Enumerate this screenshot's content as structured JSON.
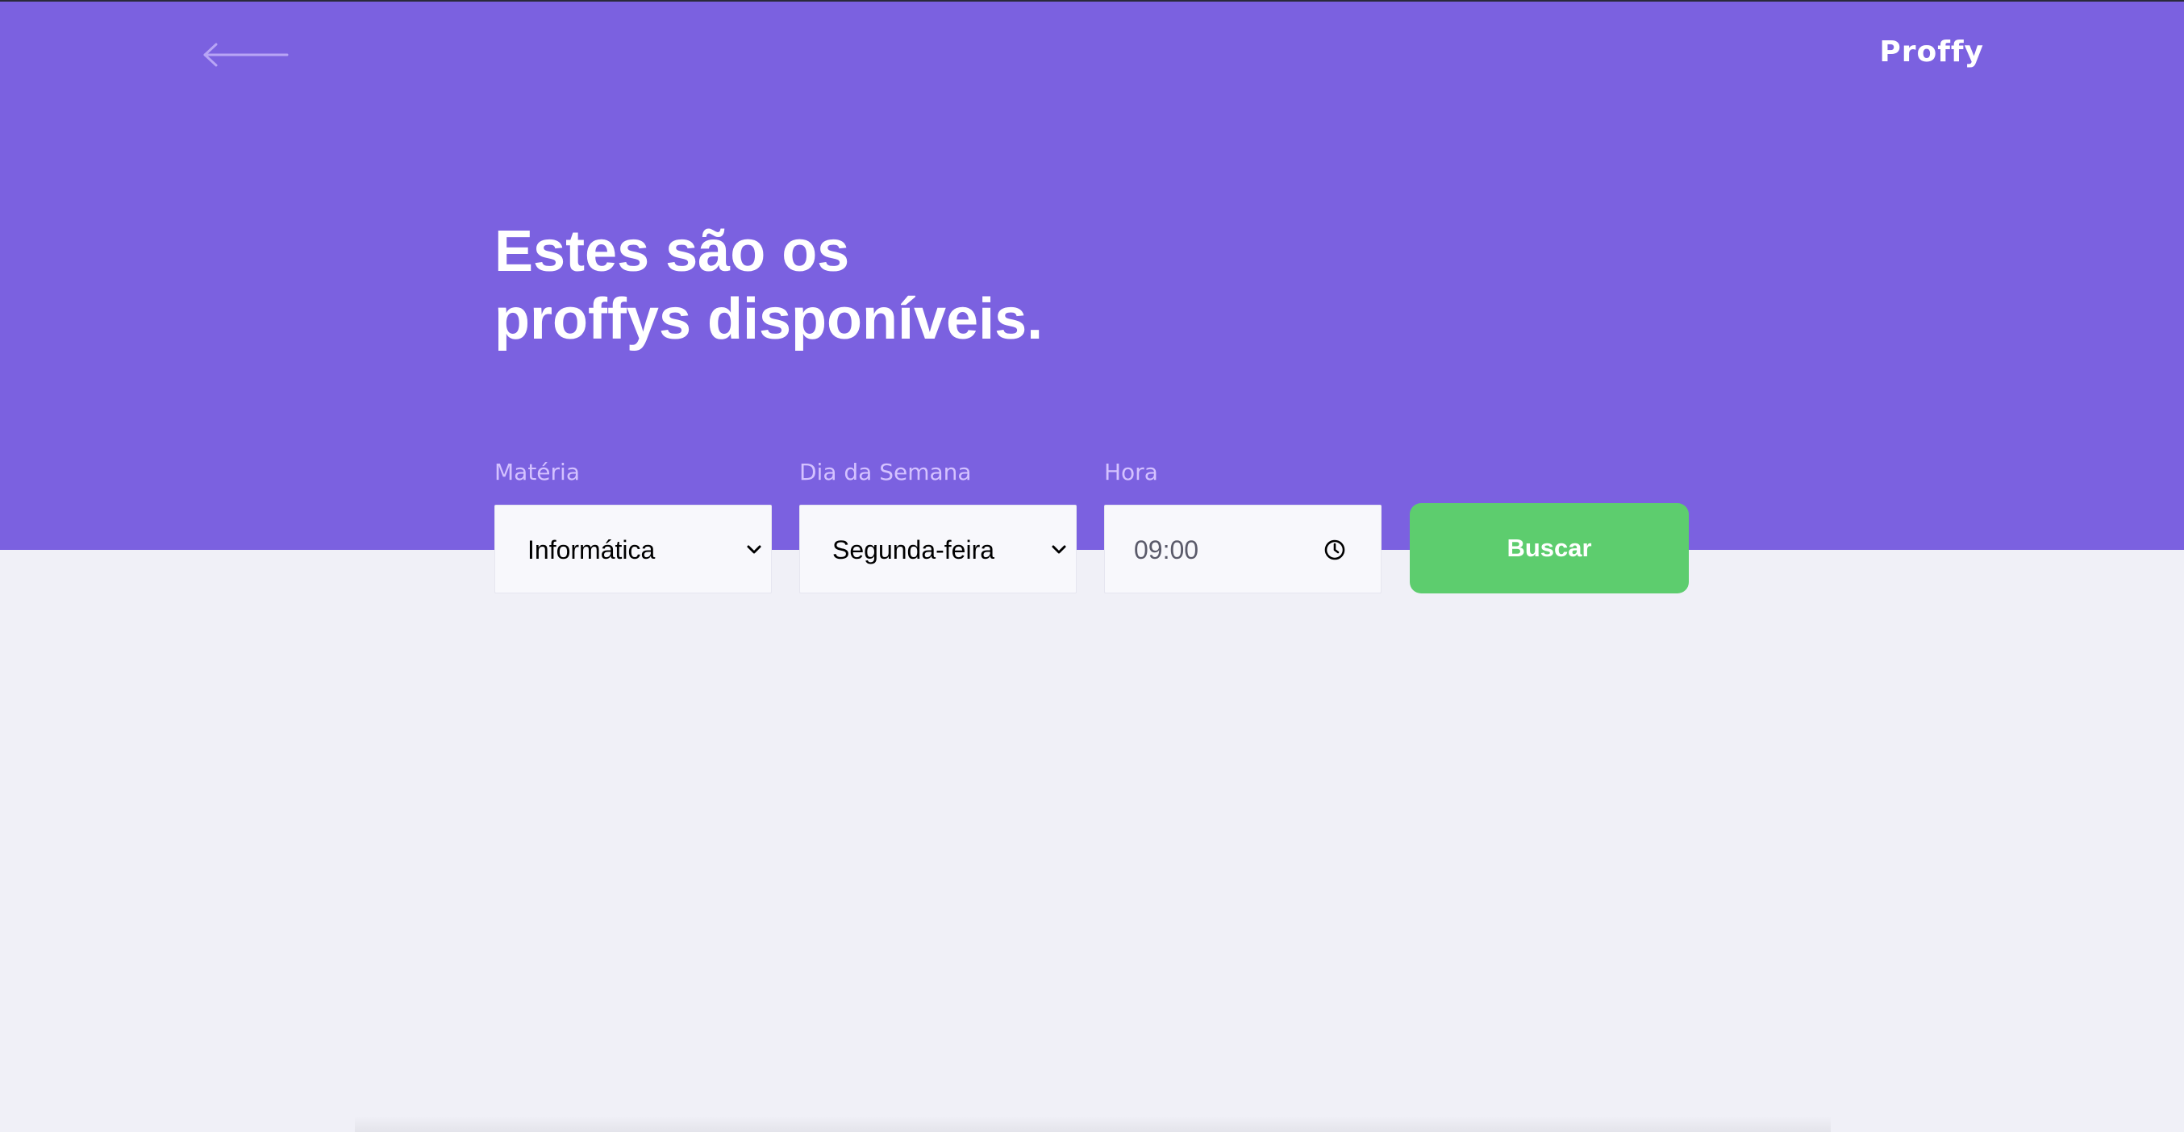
{
  "header": {
    "back_icon": "arrow-left-icon",
    "logo_text": "Proffy"
  },
  "hero": {
    "title_line1": "Estes são os",
    "title_line2": "proffys disponíveis."
  },
  "filters": {
    "subject": {
      "label": "Matéria",
      "value": "Informática"
    },
    "week_day": {
      "label": "Dia da Semana",
      "value": "Segunda-feira"
    },
    "time": {
      "label": "Hora",
      "value": "09:00",
      "icon": "clock-icon"
    },
    "search_label": "Buscar"
  },
  "colors": {
    "primary": "#7B61E0",
    "background": "#F0F0F7",
    "secondary": "#5DCD6E",
    "label": "#D4C2FF"
  }
}
